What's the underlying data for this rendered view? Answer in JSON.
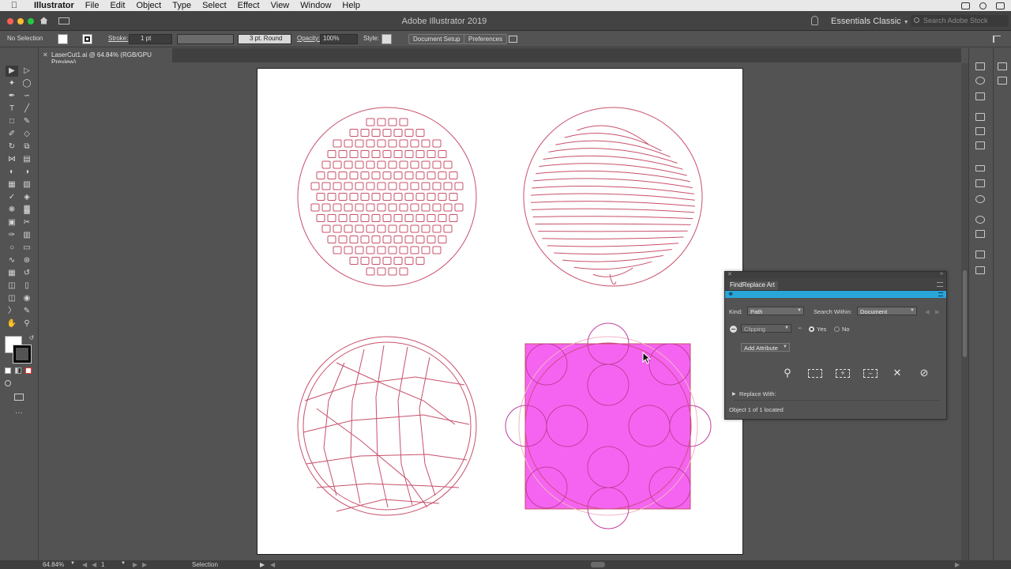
{
  "menubar": {
    "app_name": "Illustrator",
    "items": [
      "File",
      "Edit",
      "Object",
      "Type",
      "Select",
      "Effect",
      "View",
      "Window",
      "Help"
    ]
  },
  "titlebar": {
    "title": "Adobe Illustrator 2019",
    "workspace": "Essentials Classic",
    "search_placeholder": "Search Adobe Stock"
  },
  "control": {
    "selection": "No Selection",
    "stroke_label": "Stroke:",
    "stroke_weight": "1 pt",
    "brush": "3 pt. Round",
    "opacity_label": "Opacity:",
    "opacity_value": "100%",
    "style_label": "Style:",
    "doc_setup": "Document Setup",
    "preferences": "Preferences"
  },
  "document": {
    "tab_title": "LaserCut1.ai @ 64.84% (RGB/GPU Preview)"
  },
  "artwork": {
    "stroke_color": "#c8506a",
    "highlight_color": "#f564f0"
  },
  "findreplace": {
    "title": "FindReplace Art",
    "kind_label": "Kind:",
    "kind_value": "Path",
    "search_within_label": "Search Within:",
    "search_within_value": "Document",
    "attribute_value": "Clipping",
    "yes_label": "Yes",
    "no_label": "No",
    "add_attribute": "Add Attribute",
    "replace_with": "Replace With:",
    "status": "Object 1 of 1 located",
    "banner_color": "#29a6d8"
  },
  "status": {
    "zoom": "64.84%",
    "artboard": "1",
    "tool": "Selection"
  }
}
